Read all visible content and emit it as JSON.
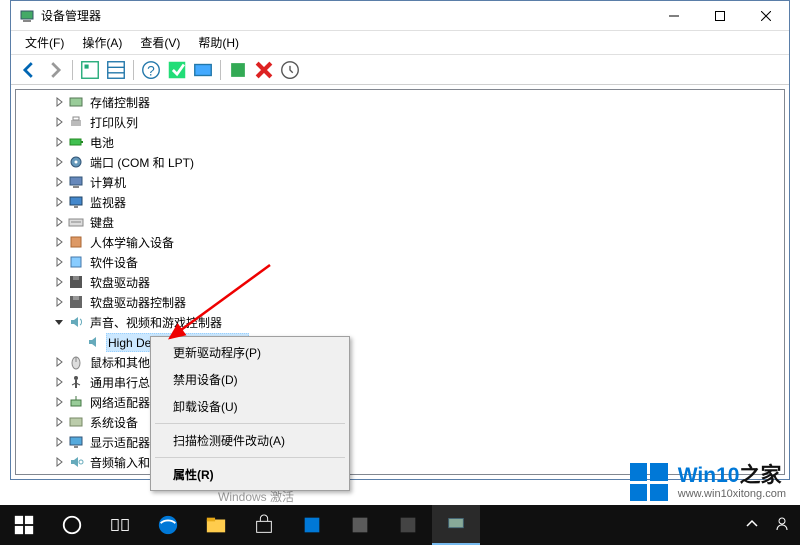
{
  "window": {
    "title": "设备管理器",
    "menus": [
      "文件(F)",
      "操作(A)",
      "查看(V)",
      "帮助(H)"
    ]
  },
  "tree": {
    "items": [
      {
        "indent": 2,
        "expand": ">",
        "icon": "storage",
        "label": "存储控制器"
      },
      {
        "indent": 2,
        "expand": ">",
        "icon": "printer",
        "label": "打印队列"
      },
      {
        "indent": 2,
        "expand": ">",
        "icon": "battery",
        "label": "电池"
      },
      {
        "indent": 2,
        "expand": ">",
        "icon": "port",
        "label": "端口 (COM 和 LPT)"
      },
      {
        "indent": 2,
        "expand": ">",
        "icon": "computer",
        "label": "计算机"
      },
      {
        "indent": 2,
        "expand": ">",
        "icon": "monitor",
        "label": "监视器"
      },
      {
        "indent": 2,
        "expand": ">",
        "icon": "keyboard",
        "label": "键盘"
      },
      {
        "indent": 2,
        "expand": ">",
        "icon": "hid",
        "label": "人体学输入设备"
      },
      {
        "indent": 2,
        "expand": ">",
        "icon": "software",
        "label": "软件设备"
      },
      {
        "indent": 2,
        "expand": ">",
        "icon": "floppy",
        "label": "软盘驱动器"
      },
      {
        "indent": 2,
        "expand": ">",
        "icon": "floppyctrl",
        "label": "软盘驱动器控制器"
      },
      {
        "indent": 2,
        "expand": "v",
        "icon": "sound",
        "label": "声音、视频和游戏控制器"
      },
      {
        "indent": 3,
        "expand": "",
        "icon": "speaker",
        "label": "High Definition Audio 设备",
        "selected": true
      },
      {
        "indent": 2,
        "expand": ">",
        "icon": "mouse",
        "label": "鼠标和其他指针设备"
      },
      {
        "indent": 2,
        "expand": ">",
        "icon": "usb",
        "label": "通用串行总线控制器"
      },
      {
        "indent": 2,
        "expand": ">",
        "icon": "network",
        "label": "网络适配器"
      },
      {
        "indent": 2,
        "expand": ">",
        "icon": "system",
        "label": "系统设备"
      },
      {
        "indent": 2,
        "expand": ">",
        "icon": "display",
        "label": "显示适配器"
      },
      {
        "indent": 2,
        "expand": ">",
        "icon": "audioin",
        "label": "音频输入和输出"
      }
    ]
  },
  "context_menu": {
    "items": [
      {
        "label": "更新驱动程序(P)"
      },
      {
        "label": "禁用设备(D)"
      },
      {
        "label": "卸载设备(U)"
      },
      {
        "sep": true
      },
      {
        "label": "扫描检测硬件改动(A)"
      },
      {
        "sep": true
      },
      {
        "label": "属性(R)",
        "bold": true
      }
    ]
  },
  "activation": "Windows 激活",
  "watermark": {
    "title_a": "Win10",
    "title_b": "之家",
    "url": "www.win10xitong.com"
  }
}
